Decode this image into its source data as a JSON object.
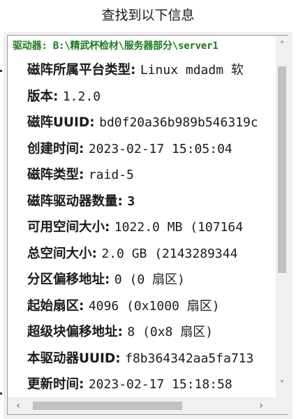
{
  "dialog": {
    "title": "查找到以下信息"
  },
  "panel": {
    "drive_header": "驱动器: B:\\精武杯检材\\服务器部分\\server1",
    "rows": [
      {
        "label": "磁阵所属平台类型: ",
        "value": "Linux mdadm 软"
      },
      {
        "label": "版本: ",
        "value": "1.2.0"
      },
      {
        "label": "磁阵UUID: ",
        "value": "bd0f20a36b989b546319c"
      },
      {
        "label": "创建时间: ",
        "value": "2023-02-17 15:05:04"
      },
      {
        "label": "磁阵类型: ",
        "value": "raid-5"
      },
      {
        "label": "磁阵驱动器数量: ",
        "value": "3"
      },
      {
        "label": "可用空间大小: ",
        "value": "1022.0 MB (107164"
      },
      {
        "label": "总空间大小: ",
        "value": "2.0 GB (2143289344 "
      },
      {
        "label": "分区偏移地址: ",
        "value": "0 (0 扇区)"
      },
      {
        "label": "起始扇区: ",
        "value": "4096 (0x1000 扇区)"
      },
      {
        "label": "超级块偏移地址: ",
        "value": "8 (0x8 扇区)"
      },
      {
        "label": "本驱动器UUID: ",
        "value": "f8b364342aa5fa713"
      },
      {
        "label": "更新时间: ",
        "value": "2023-02-17 15:18:58"
      }
    ]
  },
  "scrollbars": {
    "up_icon": "chevron-up-icon",
    "down_icon": "chevron-down-icon",
    "left_icon": "chevron-left-icon",
    "right_icon": "chevron-right-icon"
  },
  "colors": {
    "drive_header": "#1a7a1a",
    "text": "#1a1a1a",
    "scroll_thumb": "#c1c1c1"
  }
}
